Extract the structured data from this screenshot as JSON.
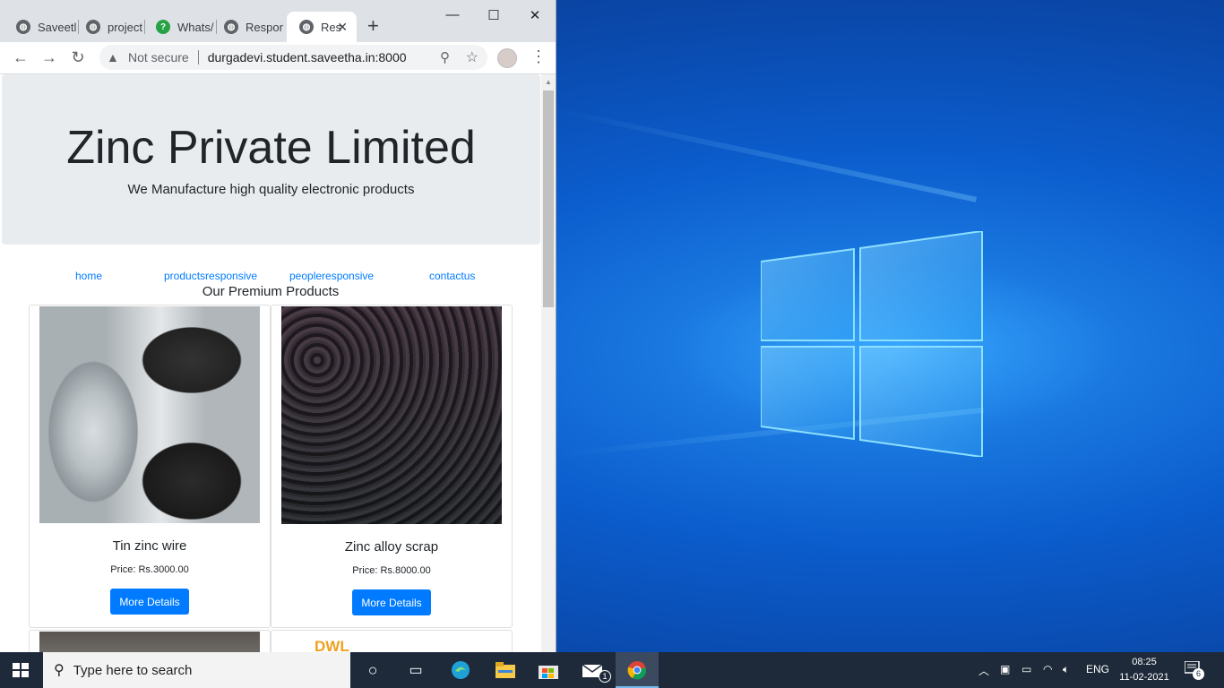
{
  "browser": {
    "tabs": [
      {
        "label": "Saveetl",
        "icon": "globe-icon"
      },
      {
        "label": "project",
        "icon": "globe-icon"
      },
      {
        "label": "Whats/",
        "icon": "whatsapp-icon"
      },
      {
        "label": "Respor",
        "icon": "globe-icon"
      },
      {
        "label": "Res",
        "icon": "globe-icon",
        "active": true
      }
    ],
    "new_tab": "+",
    "window_controls": {
      "minimize": "—",
      "maximize": "☐",
      "close": "✕"
    },
    "security_label": "Not secure",
    "url": "durgadevi.student.saveetha.in:8000"
  },
  "page": {
    "heading": "Zinc Private Limited",
    "tagline": "We Manufacture high quality electronic products",
    "nav": [
      "home",
      "productsresponsive",
      "peopleresponsive",
      "contactus"
    ],
    "section_title": "Our Premium Products",
    "products": [
      {
        "name": "Tin zinc wire",
        "price": "Price: Rs.3000.00",
        "button": "More Details"
      },
      {
        "name": "Zinc alloy scrap",
        "price": "Price: Rs.8000.00",
        "button": "More Details"
      }
    ],
    "partial_logo_text": "DWL"
  },
  "taskbar": {
    "search_placeholder": "Type here to search",
    "language": "ENG",
    "time": "08:25",
    "date": "11-02-2021",
    "mail_badge": "1",
    "notification_count": "6"
  }
}
